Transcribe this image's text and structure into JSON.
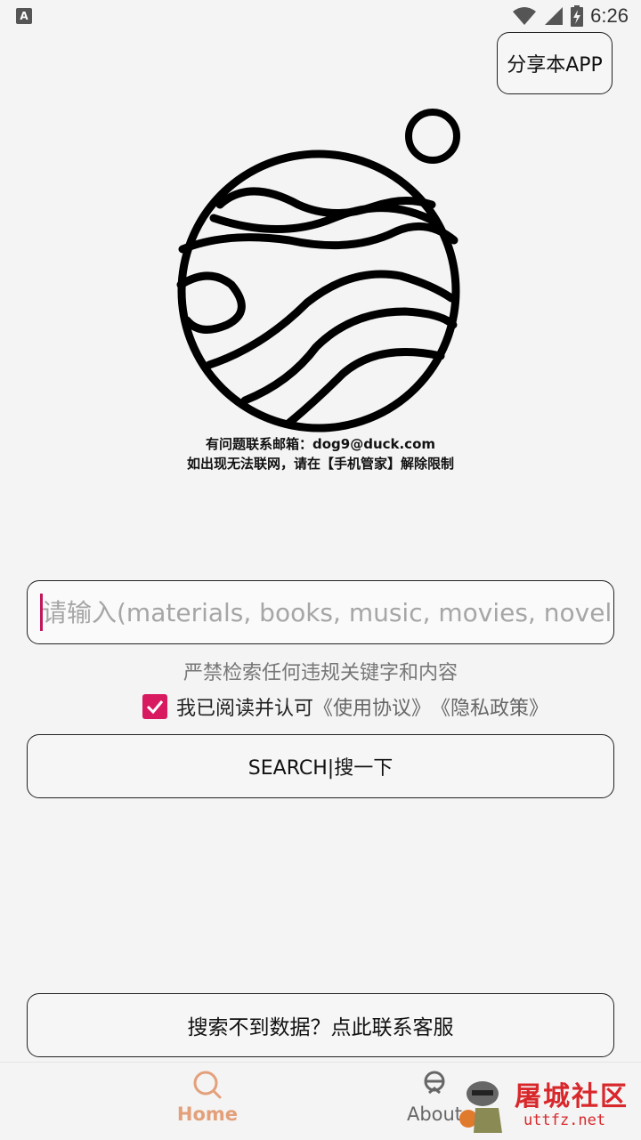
{
  "status_bar": {
    "time": "6:26",
    "left_icon": "A"
  },
  "header": {
    "share_label": "分享本APP"
  },
  "contact_info": {
    "email_line": "有问题联系邮箱：dog9@duck.com",
    "network_line": "如出现无法联网，请在【手机管家】解除限制"
  },
  "search": {
    "placeholder": "请输入(materials, books, music, movies, novel",
    "value": "",
    "warning": "严禁检索任何违规关键字和内容",
    "button_label": "SEARCH|搜一下"
  },
  "agreement": {
    "checked": true,
    "text": "我已阅读并认可",
    "terms_link": "《使用协议》",
    "privacy_link": "《隐私政策》"
  },
  "support": {
    "button_label": "搜索不到数据？点此联系客服"
  },
  "bottom_nav": {
    "items": [
      {
        "label": "Home",
        "icon": "search-icon",
        "active": true
      },
      {
        "label": "About",
        "icon": "about-icon",
        "active": false
      }
    ]
  },
  "watermark": {
    "title": "屠城社区",
    "url": "uttfz.net"
  },
  "colors": {
    "accent": "#d81b60",
    "nav_active": "#e3a07a",
    "watermark": "#d8282c"
  }
}
